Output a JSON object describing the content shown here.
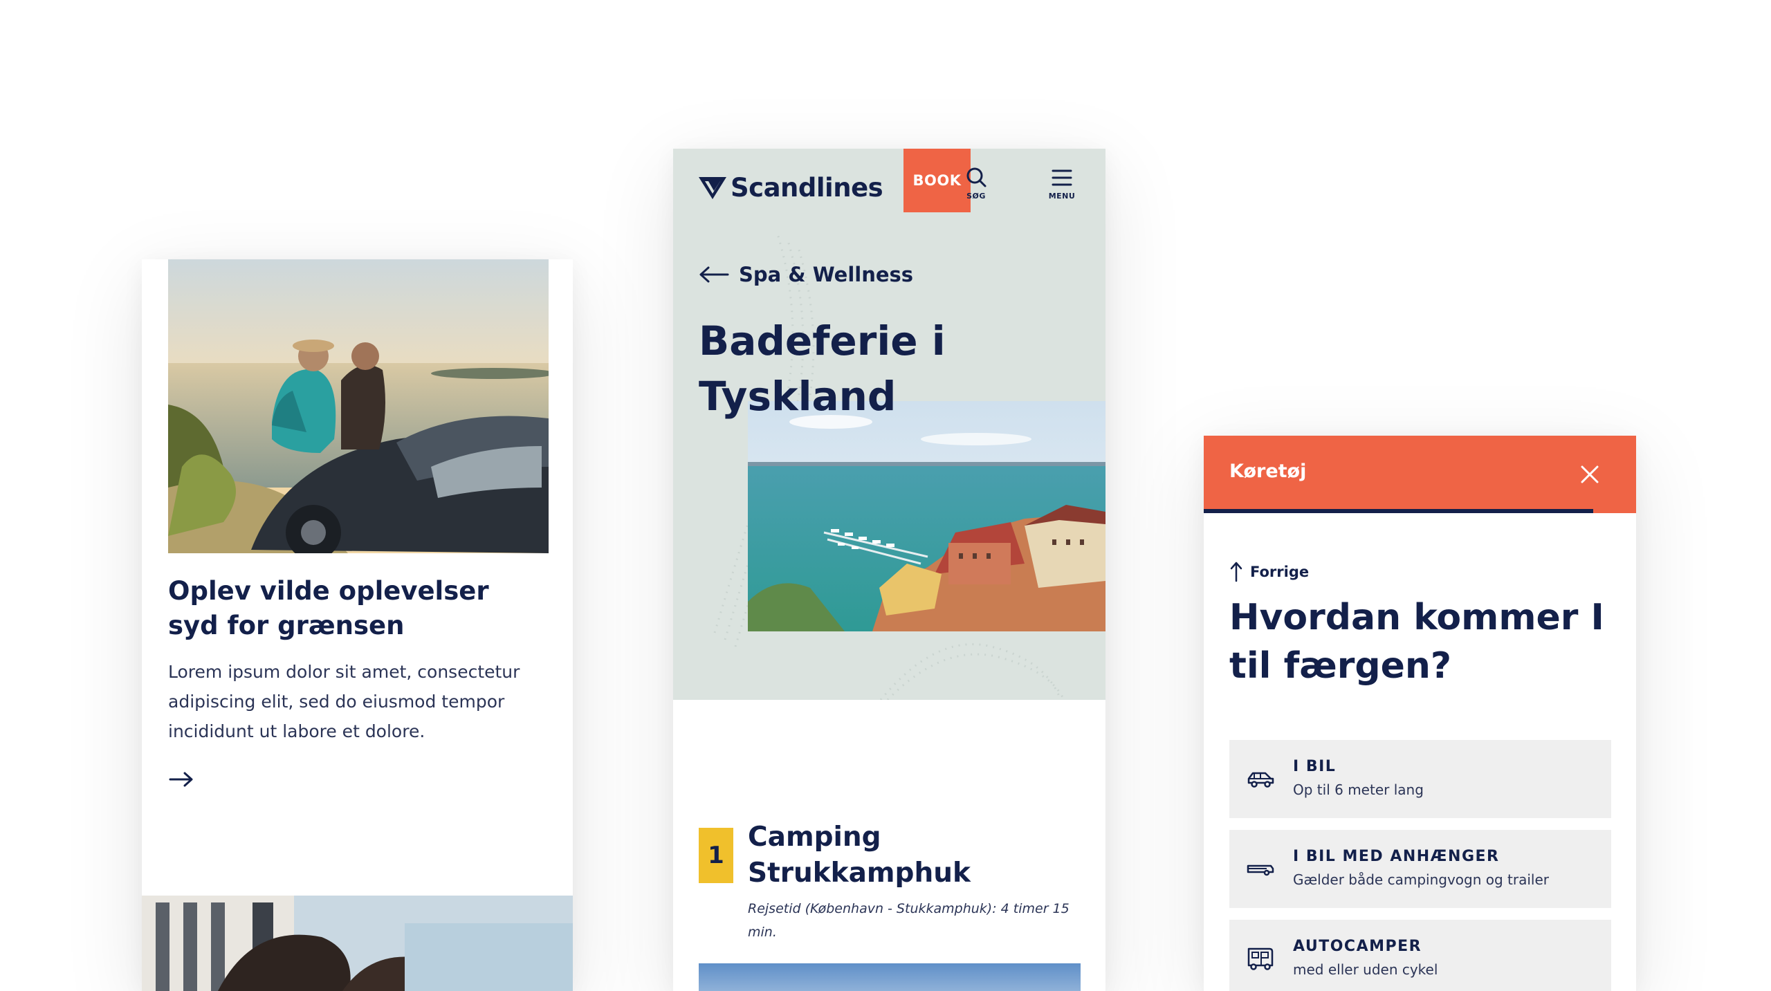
{
  "left_card": {
    "title": "Oplev vilde oplevelser syd for grænsen",
    "body": "Lorem ipsum dolor sit amet, consectetur adipiscing elit, sed do eiusmod tempor incididunt ut labore et dolore.",
    "arrow_icon": "arrow-right-icon"
  },
  "center_card": {
    "logo_text": "Scandlines",
    "book_label": "BOOK",
    "search_label": "SØG",
    "menu_label": "MENU",
    "back_label": "Spa & Wellness",
    "hero_title": "Badeferie i Tyskland",
    "item_number": "1",
    "item_title": "Camping Strukkamphuk",
    "item_subtitle": "Rejsetid (København - Stukkamphuk): 4 timer 15 min."
  },
  "right_card": {
    "panel_title": "Køretøj",
    "progress": 0.9,
    "prev_label": "Forrige",
    "question": "Hvordan kommer I til færgen?",
    "options": [
      {
        "title": "I BIL",
        "subtitle": "Op til 6 meter lang",
        "icon": "car-icon"
      },
      {
        "title": "I BIL MED ANHÆNGER",
        "subtitle": "Gælder både campingvogn og trailer",
        "icon": "trailer-icon"
      },
      {
        "title": "AUTOCAMPER",
        "subtitle": "med eller uden cykel",
        "icon": "camper-icon"
      }
    ]
  },
  "colors": {
    "navy": "#13204a",
    "orange": "#ef6445",
    "yellow": "#f0c02c",
    "hero_bg": "#dbe3df",
    "option_bg": "#efefef"
  }
}
